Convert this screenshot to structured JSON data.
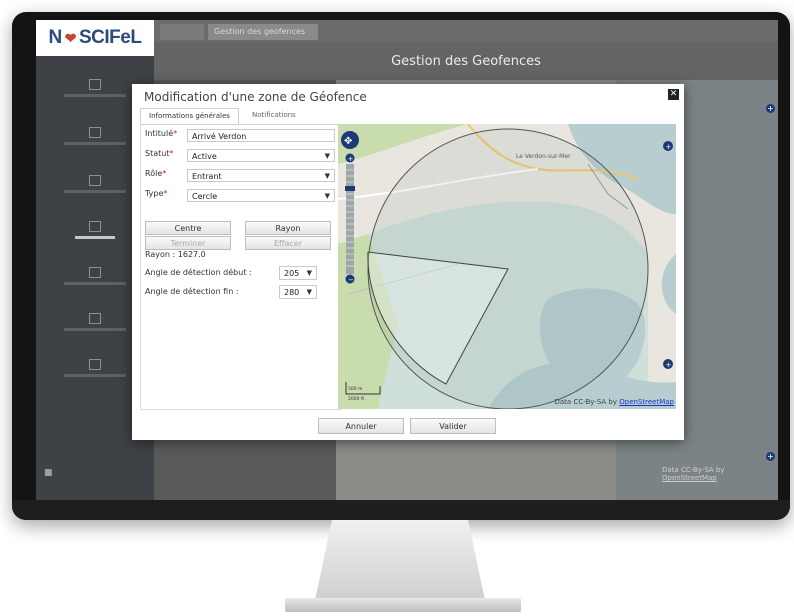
{
  "app": {
    "logo_text": "N",
    "logo_text2": "SCIFeL",
    "page_title": "Gestion des Geofences",
    "top_tab": "Gestion des geofences"
  },
  "modal": {
    "title": "Modification d'une zone de Géofence",
    "close_icon": "close-icon",
    "tabs": [
      {
        "label": "Informations générales",
        "active": true
      },
      {
        "label": "Notifications",
        "active": false
      }
    ],
    "fields": {
      "intitule_label": "Intitulé",
      "intitule_value": "Arrivé Verdon",
      "statut_label": "Statut",
      "statut_value": "Active",
      "role_label": "Rôle",
      "role_value": "Entrant",
      "type_label": "Type",
      "type_value": "Cercle",
      "required_mark": "*"
    },
    "buttons": {
      "centre": "Centre",
      "rayon": "Rayon",
      "terminer": "Terminer",
      "effacer": "Effacer"
    },
    "rayon_text": "Rayon : 1627.0",
    "angle_debut_label": "Angle de détection début :",
    "angle_debut_value": "205",
    "angle_fin_label": "Angle de détection fin :",
    "angle_fin_value": "280",
    "map": {
      "town_label": "Le Verdon-sur-Mer",
      "attribution": "Data CC-By-SA by",
      "attribution_link": "OpenStreetMap",
      "scale_top": "500 m",
      "scale_bottom": "2000 ft"
    },
    "footer": {
      "annuler": "Annuler",
      "valider": "Valider"
    }
  },
  "background_map": {
    "attribution": "Data CC-By-SA by",
    "attribution_link": "OpenStreetMap"
  },
  "colors": {
    "map_land": "#e9e6df",
    "map_sea": "#b7cdd0",
    "map_marsh": "#cfe0d8",
    "map_green": "#c8dcae",
    "map_control": "#1e3a74",
    "modal_bg": "#ffffff",
    "required": "#d02020",
    "link": "#1a35c4"
  }
}
